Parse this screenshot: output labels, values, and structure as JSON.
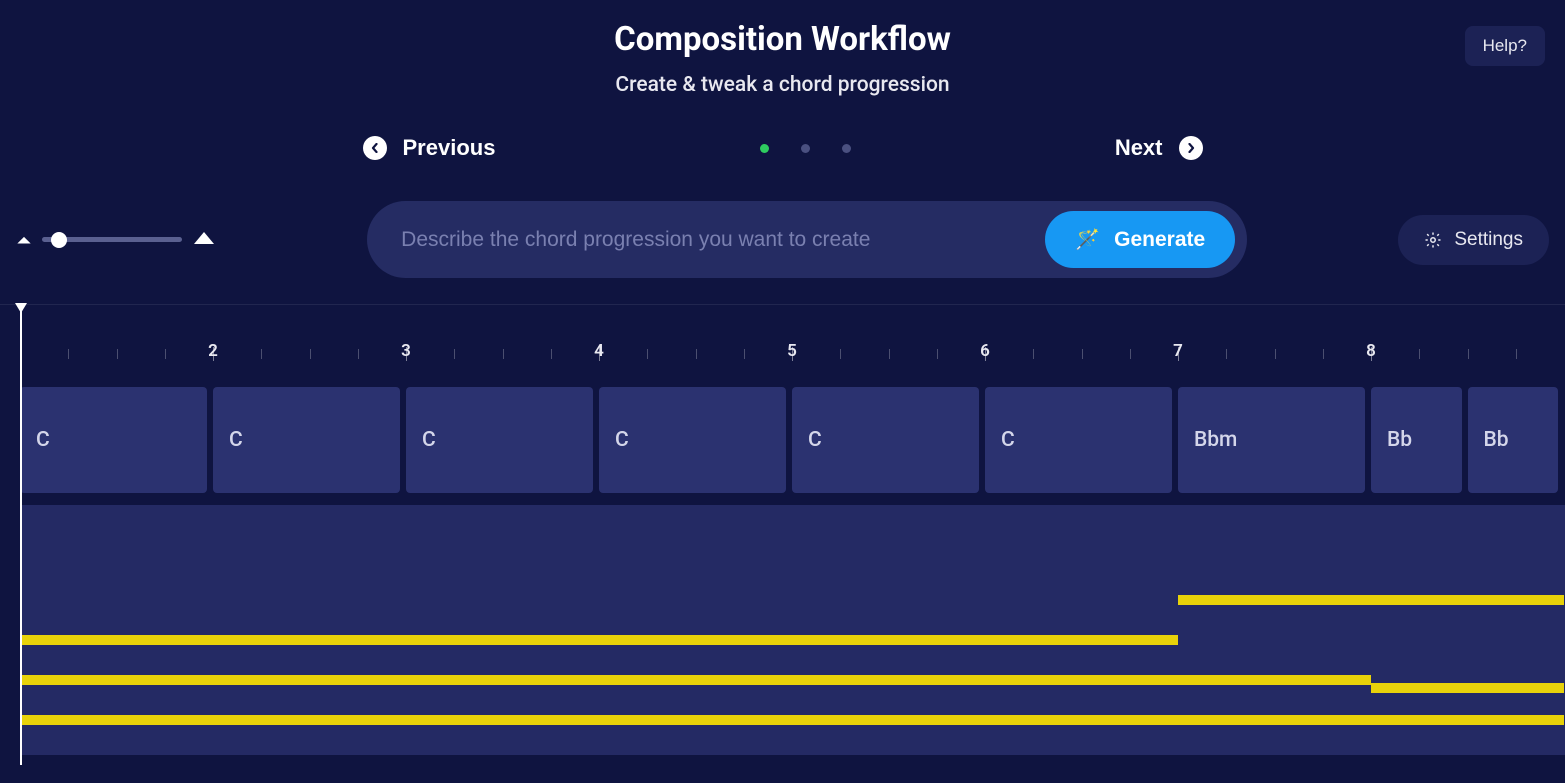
{
  "header": {
    "title": "Composition Workflow",
    "subtitle": "Create & tweak a chord progression"
  },
  "help": {
    "label": "Help?"
  },
  "nav": {
    "previous": "Previous",
    "next": "Next",
    "active_step": 0,
    "total_steps": 3
  },
  "prompt": {
    "placeholder": "Describe the chord progression you want to create",
    "value": "",
    "generate": "Generate"
  },
  "settings": {
    "label": "Settings"
  },
  "zoom": {
    "value": 12
  },
  "ruler": {
    "bars": 8,
    "subdivisions": 4,
    "pxPerBar": 193
  },
  "chords": [
    {
      "label": "C",
      "beats": 4
    },
    {
      "label": "C",
      "beats": 4
    },
    {
      "label": "C",
      "beats": 4
    },
    {
      "label": "C",
      "beats": 4
    },
    {
      "label": "C",
      "beats": 4
    },
    {
      "label": "C",
      "beats": 4
    },
    {
      "label": "Bbm",
      "beats": 4
    },
    {
      "label": "Bb",
      "beats": 2
    },
    {
      "label": "Bb",
      "beats": 2
    }
  ],
  "notes": [
    {
      "start": 0,
      "length": 24,
      "lane": 2
    },
    {
      "start": 0,
      "length": 24,
      "lane": 3
    },
    {
      "start": 0,
      "length": 24,
      "lane": 4
    },
    {
      "start": 24,
      "length": 8,
      "lane": 1
    },
    {
      "start": 24,
      "length": 4,
      "lane": 3
    },
    {
      "start": 24,
      "length": 8,
      "lane": 4
    },
    {
      "start": 28,
      "length": 4,
      "lane": 3.2
    }
  ],
  "colors": {
    "bg": "#0f1440",
    "panel": "#2b3270",
    "accent": "#1798f3",
    "note": "#e8d20a",
    "stepActive": "#2ecb5f"
  }
}
